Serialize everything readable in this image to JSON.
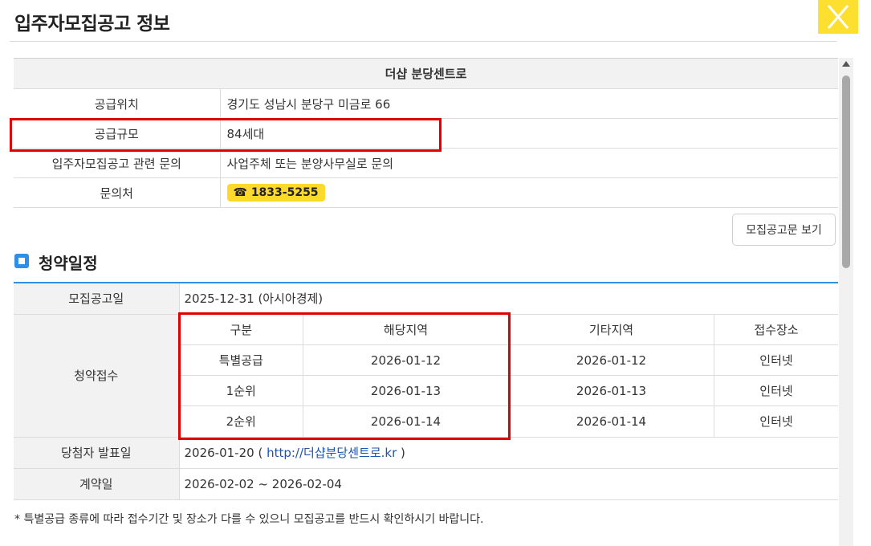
{
  "header": {
    "title": "입주자모집공고 정보"
  },
  "info": {
    "complex_name": "더샵 분당센트로",
    "rows": [
      {
        "label": "공급위치",
        "value": "경기도 성남시 분당구 미금로 66"
      },
      {
        "label": "공급규모",
        "value": "84세대"
      },
      {
        "label": "입주자모집공고 관련 문의",
        "value": "사업주체 또는 분양사무실로 문의"
      },
      {
        "label": "문의처",
        "value": "☎ 1833-5255"
      }
    ],
    "view_button": "모집공고문 보기"
  },
  "schedule": {
    "section_title": "청약일정",
    "notice_label": "모집공고일",
    "notice_value": "2025-12-31 (아시아경제)",
    "apply_label": "청약접수",
    "columns": [
      "구분",
      "해당지역",
      "기타지역",
      "접수장소"
    ],
    "rows": [
      [
        "특별공급",
        "2026-01-12",
        "2026-01-12",
        "인터넷"
      ],
      [
        "1순위",
        "2026-01-13",
        "2026-01-13",
        "인터넷"
      ],
      [
        "2순위",
        "2026-01-14",
        "2026-01-14",
        "인터넷"
      ]
    ],
    "winner_label": "당첨자 발표일",
    "winner_date": "2026-01-20 (",
    "winner_link": " http://더샵분당센트로.kr ",
    "winner_close": ")",
    "contract_label": "계약일",
    "contract_value": "2026-02-02 ~ 2026-02-04"
  },
  "note": "* 특별공급 종류에 따라 접수기간 및 장소가 다를 수 있으니 모집공고를 반드시 확인하시기 바랍니다.",
  "colors": {
    "accent": "#2f8fe6",
    "badge": "#fcd92b",
    "close": "#fde02f",
    "highlight": "#e00000",
    "link": "#1a55b5"
  }
}
